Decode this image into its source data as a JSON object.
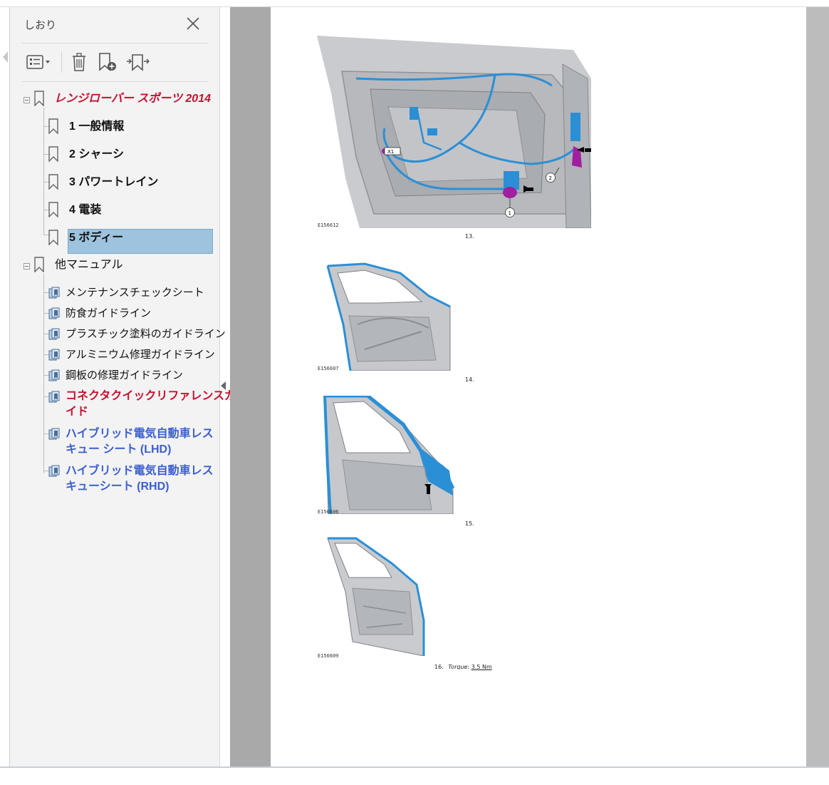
{
  "sidebar": {
    "title": "しおり",
    "root": {
      "label": "レンジローバー スポーツ 2014"
    },
    "chapters": [
      {
        "label": "1 一般情報"
      },
      {
        "label": "2 シャーシ"
      },
      {
        "label": "3 パワートレイン"
      },
      {
        "label": "4 電装"
      },
      {
        "label": "5 ボディー",
        "selected": true
      }
    ],
    "other": {
      "label": "他マニュアル"
    },
    "docs": [
      {
        "label": "メンテナンスチェックシート",
        "style": "normal"
      },
      {
        "label": "防食ガイドライン",
        "style": "normal"
      },
      {
        "label": "プラスチック塗料のガイドライン",
        "style": "normal"
      },
      {
        "label": "アルミニウム修理ガイドライン",
        "style": "normal"
      },
      {
        "label": "鋼板の修理ガイドライン",
        "style": "normal"
      },
      {
        "line1": "コネクタクイックリファレンスガ",
        "line2": "イド",
        "style": "red"
      },
      {
        "line1": "ハイブリッド電気自動車レス",
        "line2": "キュー シート (LHD)",
        "style": "blue"
      },
      {
        "line1": "ハイブリッド電気自動車レス",
        "line2": "キューシート (RHD)",
        "style": "blue"
      }
    ]
  },
  "document": {
    "figures": [
      {
        "code": "E156612",
        "step": "13.",
        "callouts": [
          "1",
          "2",
          "X1"
        ]
      },
      {
        "code": "E156607",
        "step": "14."
      },
      {
        "code": "E156606",
        "step": "15."
      },
      {
        "code": "E156609",
        "step": "16.",
        "torque_label": "Torque:",
        "torque_value": "3.5 Nm"
      }
    ]
  },
  "colors": {
    "accent_red": "#c8102e",
    "link_blue": "#3b5fd0",
    "selection": "#9dc3de",
    "harness": "#2b8fd6",
    "clip": "#a020a0"
  }
}
